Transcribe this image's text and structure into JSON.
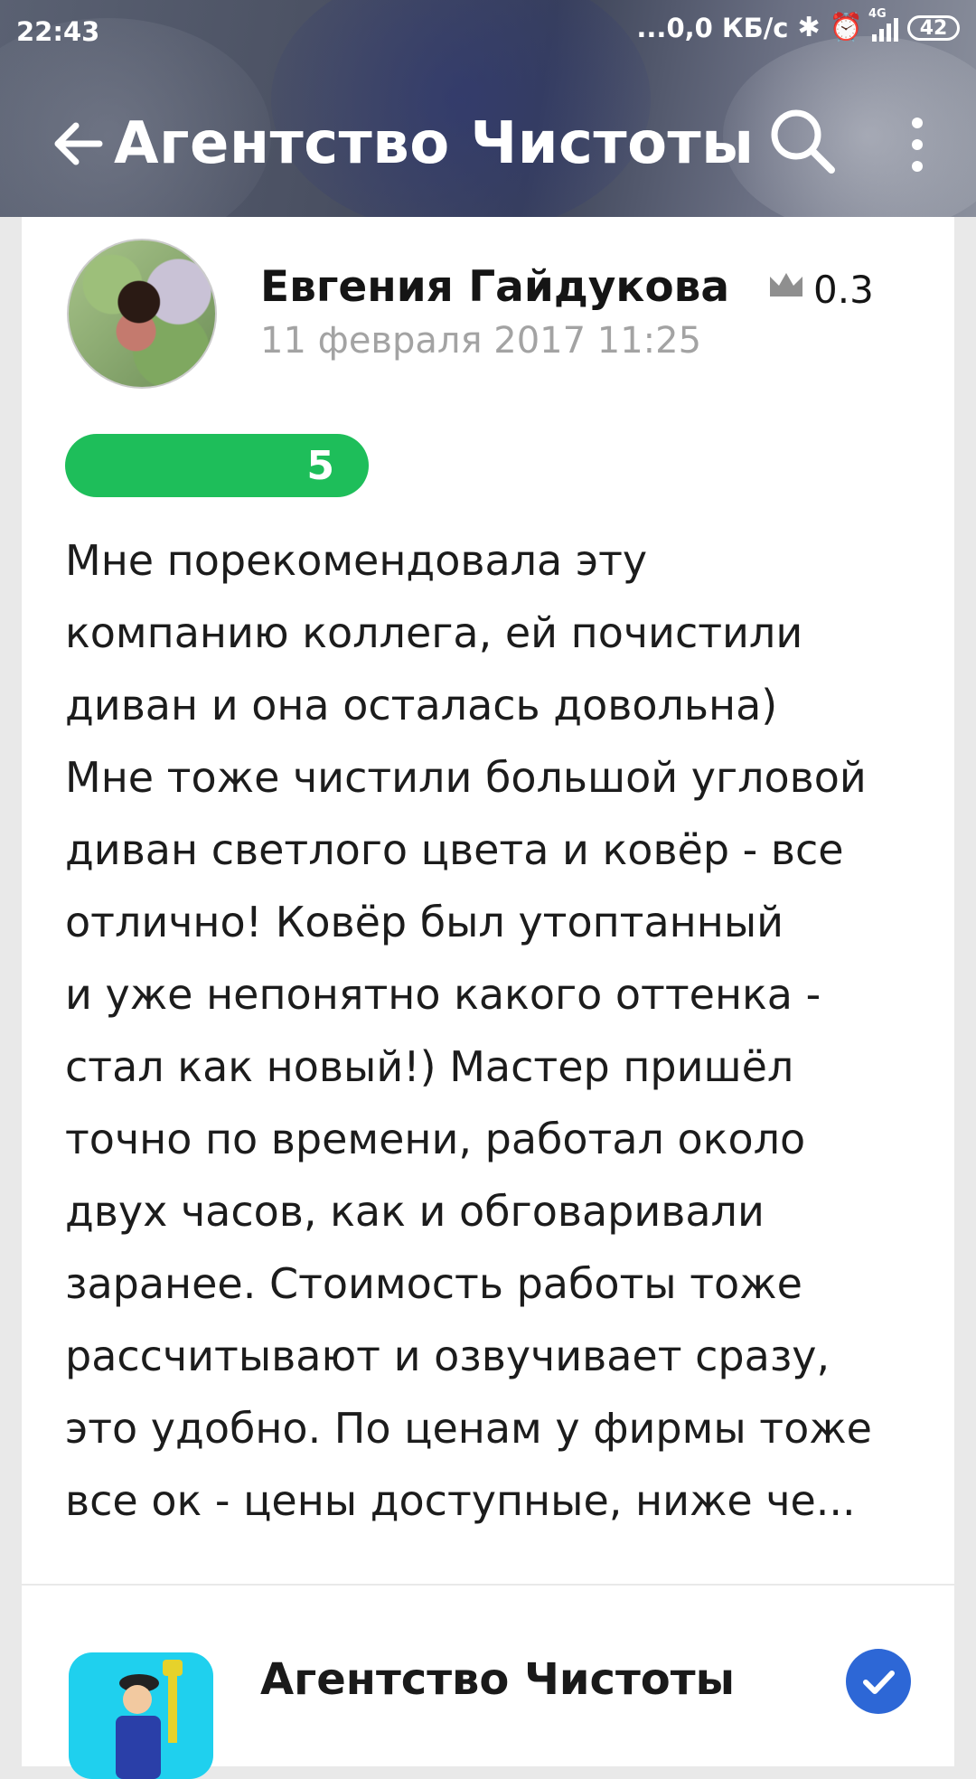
{
  "status_bar": {
    "time": "22:43",
    "speed": "...0,0 КБ/с",
    "network_label": "4G",
    "battery": "42"
  },
  "toolbar": {
    "title": "Агентство Чистоты"
  },
  "review": {
    "author_name": "Евгения Гайдукова",
    "author_rating": "0.3",
    "date": "11 февраля 2017 11:25",
    "score": "5",
    "score_color": "#1ebe5a",
    "text": "Мне порекомендовала эту\nкомпанию коллега, ей почистили\nдиван и она осталась довольна)\nМне тоже чистили большой угловой\nдиван светлого цвета и ковёр - все\nотлично!  Ковёр был утоптанный\nи уже непонятно какого оттенка -\nстал как новый!) Мастер пришёл\nточно по времени, работал около\nдвух часов, как и обговаривали\nзаранее. Стоимость работы тоже\nрассчитывают и озвучивает сразу,\nэто удобно. По ценам у фирмы тоже\nвсе ок - цены доступные, ниже че..."
  },
  "reply": {
    "company_name": "Агентство Чистоты",
    "verified_color": "#2d67d6"
  }
}
